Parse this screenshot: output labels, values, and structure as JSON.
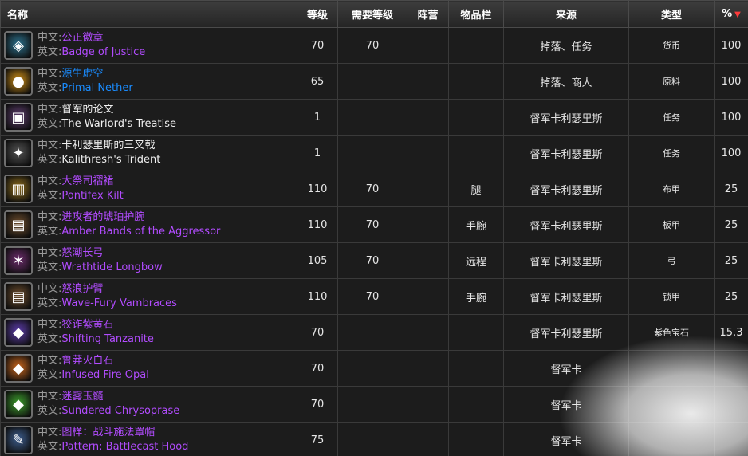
{
  "header": {
    "name": "名称",
    "level": "等级",
    "req_level": "需要等级",
    "faction": "阵营",
    "slot": "物品栏",
    "source": "来源",
    "type": "类型",
    "percent": "%"
  },
  "labels": {
    "cn": "中文:",
    "en": "英文:"
  },
  "rows": [
    {
      "cn": "公正徽章",
      "en": "Badge of Justice",
      "quality": "purple",
      "level": "70",
      "req": "70",
      "faction": "",
      "slot": "",
      "source": "掉落、任务",
      "type": "货币",
      "pct": "100",
      "icon": "badge-icon",
      "icon_bg": "#2a6f8a",
      "glyph": "◈"
    },
    {
      "cn": "源生虚空",
      "en": "Primal Nether",
      "quality": "blue",
      "level": "65",
      "req": "",
      "faction": "",
      "slot": "",
      "source": "掉落、商人",
      "type": "原料",
      "pct": "100",
      "icon": "orb-icon",
      "icon_bg": "#c98a12",
      "glyph": "●"
    },
    {
      "cn": "督军的论文",
      "en": "The Warlord's Treatise",
      "quality": "white",
      "level": "1",
      "req": "",
      "faction": "",
      "slot": "",
      "source": "督军卡利瑟里斯",
      "type": "任务",
      "pct": "100",
      "icon": "chest-icon",
      "icon_bg": "#5a3a6a",
      "glyph": "▣"
    },
    {
      "cn": "卡利瑟里斯的三叉戟",
      "en": "Kalithresh's Trident",
      "quality": "white",
      "level": "1",
      "req": "",
      "faction": "",
      "slot": "",
      "source": "督军卡利瑟里斯",
      "type": "任务",
      "pct": "100",
      "icon": "trident-icon",
      "icon_bg": "#505050",
      "glyph": "✦"
    },
    {
      "cn": "大祭司褶裙",
      "en": "Pontifex Kilt",
      "quality": "purple",
      "level": "110",
      "req": "70",
      "faction": "",
      "slot": "腿",
      "source": "督军卡利瑟里斯",
      "type": "布甲",
      "pct": "25",
      "icon": "kilt-icon",
      "icon_bg": "#8a6a1a",
      "glyph": "▥"
    },
    {
      "cn": "进攻者的琥珀护腕",
      "en": "Amber Bands of the Aggressor",
      "quality": "purple",
      "level": "110",
      "req": "70",
      "faction": "",
      "slot": "手腕",
      "source": "督军卡利瑟里斯",
      "type": "板甲",
      "pct": "25",
      "icon": "bracer-icon",
      "icon_bg": "#6a4a2a",
      "glyph": "▤"
    },
    {
      "cn": "怒潮长弓",
      "en": "Wrathtide Longbow",
      "quality": "purple",
      "level": "105",
      "req": "70",
      "faction": "",
      "slot": "远程",
      "source": "督军卡利瑟里斯",
      "type": "弓",
      "pct": "25",
      "icon": "bow-icon",
      "icon_bg": "#6a2a6a",
      "glyph": "✶"
    },
    {
      "cn": "怒浪护臂",
      "en": "Wave-Fury Vambraces",
      "quality": "purple",
      "level": "110",
      "req": "70",
      "faction": "",
      "slot": "手腕",
      "source": "督军卡利瑟里斯",
      "type": "锁甲",
      "pct": "25",
      "icon": "vambrace-icon",
      "icon_bg": "#6a4a2a",
      "glyph": "▤"
    },
    {
      "cn": "狡诈紫黄石",
      "en": "Shifting Tanzanite",
      "quality": "purple",
      "level": "70",
      "req": "",
      "faction": "",
      "slot": "",
      "source": "督军卡利瑟里斯",
      "type": "紫色宝石",
      "pct": "15.3",
      "icon": "gem-purple-icon",
      "icon_bg": "#5a3aa8",
      "glyph": "◆"
    },
    {
      "cn": "鲁莽火白石",
      "en": "Infused Fire Opal",
      "quality": "purple",
      "level": "70",
      "req": "",
      "faction": "",
      "slot": "",
      "source": "督军卡",
      "type": "",
      "pct": "",
      "icon": "gem-orange-icon",
      "icon_bg": "#c8641a",
      "glyph": "◆"
    },
    {
      "cn": "迷雾玉髓",
      "en": "Sundered Chrysoprase",
      "quality": "purple",
      "level": "70",
      "req": "",
      "faction": "",
      "slot": "",
      "source": "督军卡",
      "type": "",
      "pct": "",
      "icon": "gem-green-icon",
      "icon_bg": "#3a9a2a",
      "glyph": "◆"
    },
    {
      "cn": "图样：战斗施法罩帽",
      "en": "Pattern: Battlecast Hood",
      "quality": "purple",
      "level": "75",
      "req": "",
      "faction": "",
      "slot": "",
      "source": "督军卡",
      "type": "",
      "pct": "",
      "icon": "scroll-icon",
      "icon_bg": "#3a5a8a",
      "glyph": "✎"
    }
  ]
}
